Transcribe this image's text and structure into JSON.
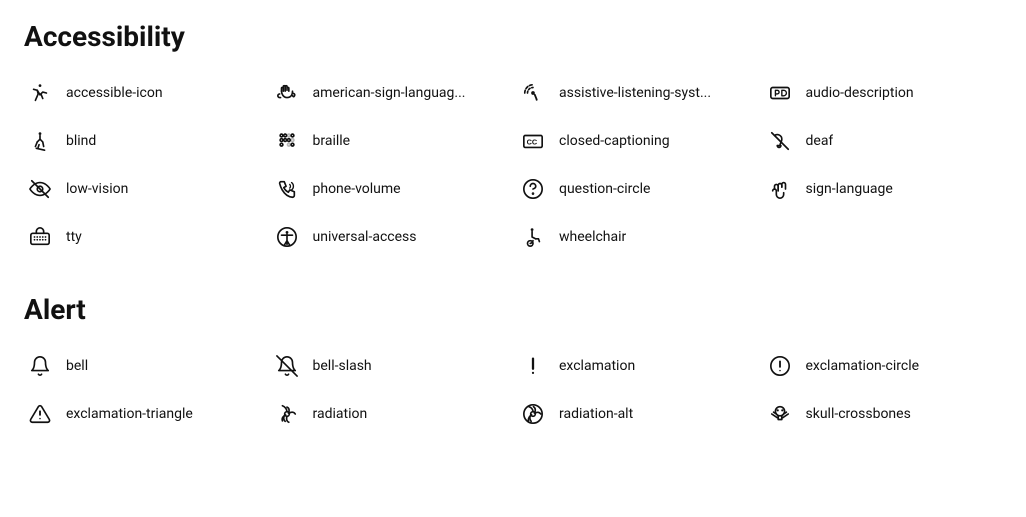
{
  "sections": [
    {
      "title": "Accessibility",
      "icons": [
        {
          "name": "accessible-icon",
          "label": "accessible-icon"
        },
        {
          "name": "american-sign-language",
          "label": "american-sign-languag..."
        },
        {
          "name": "assistive-listening-systems",
          "label": "assistive-listening-syst..."
        },
        {
          "name": "audio-description",
          "label": "audio-description"
        },
        {
          "name": "blind",
          "label": "blind"
        },
        {
          "name": "braille",
          "label": "braille"
        },
        {
          "name": "closed-captioning",
          "label": "closed-captioning"
        },
        {
          "name": "deaf",
          "label": "deaf"
        },
        {
          "name": "low-vision",
          "label": "low-vision"
        },
        {
          "name": "phone-volume",
          "label": "phone-volume"
        },
        {
          "name": "question-circle",
          "label": "question-circle"
        },
        {
          "name": "sign-language",
          "label": "sign-language"
        },
        {
          "name": "tty",
          "label": "tty"
        },
        {
          "name": "universal-access",
          "label": "universal-access"
        },
        {
          "name": "wheelchair",
          "label": "wheelchair"
        },
        {
          "name": "empty",
          "label": ""
        }
      ]
    },
    {
      "title": "Alert",
      "icons": [
        {
          "name": "bell",
          "label": "bell"
        },
        {
          "name": "bell-slash",
          "label": "bell-slash"
        },
        {
          "name": "exclamation",
          "label": "exclamation"
        },
        {
          "name": "exclamation-circle",
          "label": "exclamation-circle"
        },
        {
          "name": "exclamation-triangle",
          "label": "exclamation-triangle"
        },
        {
          "name": "radiation",
          "label": "radiation"
        },
        {
          "name": "radiation-alt",
          "label": "radiation-alt"
        },
        {
          "name": "skull-crossbones",
          "label": "skull-crossbones"
        }
      ]
    }
  ]
}
